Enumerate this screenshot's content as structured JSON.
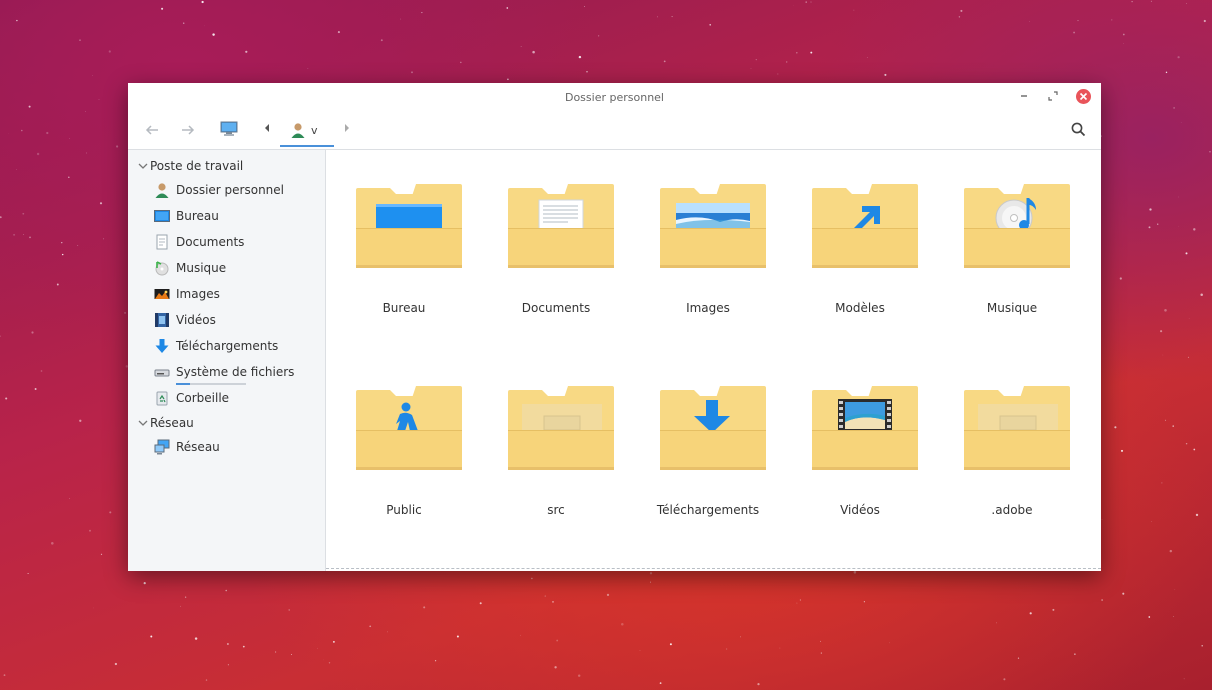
{
  "window": {
    "title": "Dossier personnel"
  },
  "toolbar": {
    "home_crumb_label": "v"
  },
  "sidebar": {
    "sections": [
      {
        "label": "Poste de travail",
        "items": [
          {
            "label": "Dossier personnel",
            "icon": "user-home-icon"
          },
          {
            "label": "Bureau",
            "icon": "desktop-icon"
          },
          {
            "label": "Documents",
            "icon": "document-icon"
          },
          {
            "label": "Musique",
            "icon": "music-icon"
          },
          {
            "label": "Images",
            "icon": "picture-icon"
          },
          {
            "label": "Vidéos",
            "icon": "video-icon"
          },
          {
            "label": "Téléchargements",
            "icon": "download-icon"
          },
          {
            "label": "Système de fichiers",
            "icon": "drive-icon"
          },
          {
            "label": "Corbeille",
            "icon": "trash-icon"
          }
        ]
      },
      {
        "label": "Réseau",
        "items": [
          {
            "label": "Réseau",
            "icon": "network-icon"
          }
        ]
      }
    ],
    "filesystem_usage": 0.2
  },
  "folders": [
    {
      "name": "Bureau",
      "emblem": "desktop"
    },
    {
      "name": "Documents",
      "emblem": "documents"
    },
    {
      "name": "Images",
      "emblem": "pictures"
    },
    {
      "name": "Modèles",
      "emblem": "templates"
    },
    {
      "name": "Musique",
      "emblem": "music"
    },
    {
      "name": "Public",
      "emblem": "public"
    },
    {
      "name": "src",
      "emblem": "generic"
    },
    {
      "name": "Téléchargements",
      "emblem": "downloads"
    },
    {
      "name": "Vidéos",
      "emblem": "videos"
    },
    {
      "name": ".adobe",
      "emblem": "generic"
    }
  ],
  "colors": {
    "accent": "#4a90d9",
    "folder": "#f8d984",
    "folder_front": "#f7d47a",
    "close_button": "#e9545a"
  }
}
